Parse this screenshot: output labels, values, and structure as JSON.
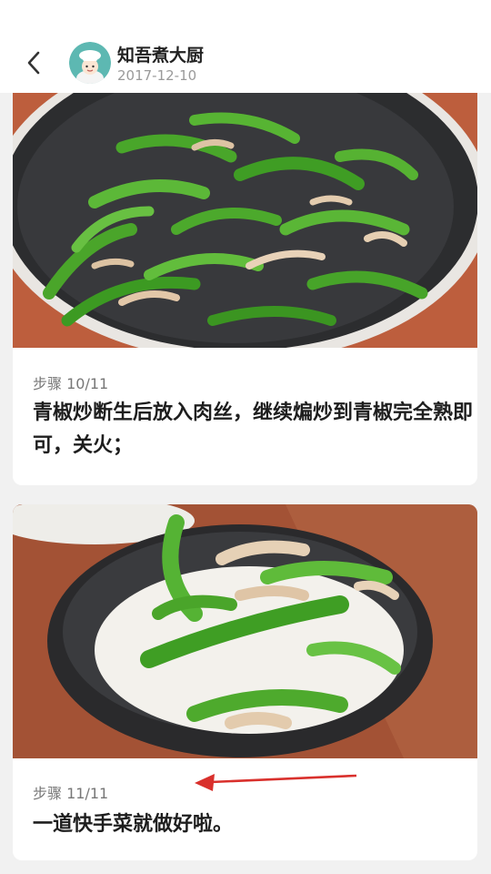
{
  "header": {
    "back_icon": "chevron-left-icon",
    "author_name": "知吾煮大厨",
    "date": "2017-12-10",
    "avatar_icon": "chef-avatar-icon"
  },
  "steps": [
    {
      "label": "步骤 10/11",
      "text": "青椒炒断生后放入肉丝，继续煸炒到青椒完全熟即可，关火；",
      "image": "stir-fry-pan-photo"
    },
    {
      "label": "步骤 11/11",
      "text": "一道快手菜就做好啦。",
      "image": "pepper-pork-rice-bowl-photo"
    }
  ],
  "colors": {
    "background": "#f1f1f1",
    "card": "#ffffff",
    "annotation_arrow": "#d9302c"
  }
}
